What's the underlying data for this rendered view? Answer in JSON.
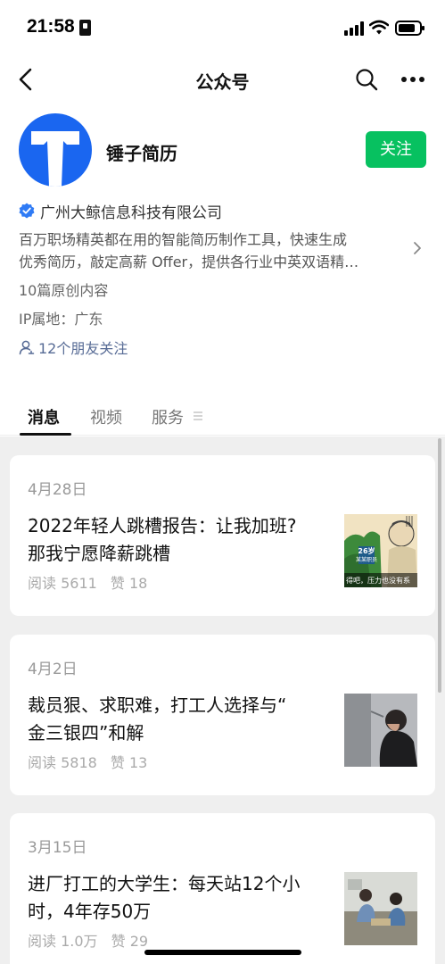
{
  "status_bar": {
    "time": "21:58"
  },
  "navbar": {
    "title": "公众号"
  },
  "account": {
    "name": "锤子简历",
    "follow_label": "关注",
    "company": "广州大鲸信息科技有限公司",
    "description_line1": "百万职场精英都在用的智能简历制作工具，快速生成",
    "description_line2": "优秀简历，敲定高薪 Offer，提供各行业中英双语精…",
    "original_count": "10篇原创内容",
    "ip_location": "IP属地：广东",
    "friends_following": "12个朋友关注"
  },
  "tabs": [
    {
      "label": "消息"
    },
    {
      "label": "视频"
    },
    {
      "label": "服务"
    }
  ],
  "articles": [
    {
      "date": "4月28日",
      "title_line1": "2022年轻人跳槽报告：让我加班?",
      "title_line2": "那我宁愿降薪跳槽",
      "reads": "阅读 5611",
      "likes": "赞 18",
      "thumb_tag": "26岁",
      "thumb_role": "某某职员",
      "thumb_caption": "得吧，压力也没有系"
    },
    {
      "date": "4月2日",
      "title_line1": "裁员狠、求职难，打工人选择与“",
      "title_line2": "金三银四”和解",
      "reads": "阅读 5818",
      "likes": "赞 13"
    },
    {
      "date": "3月15日",
      "title_line1": "进厂打工的大学生：每天站12个小",
      "title_line2": "时，4年存50万",
      "reads": "阅读 1.0万",
      "likes": "赞 29"
    }
  ],
  "colors": {
    "accent_green": "#07c160",
    "link_blue": "#576b95",
    "avatar_blue": "#1a66f0"
  }
}
